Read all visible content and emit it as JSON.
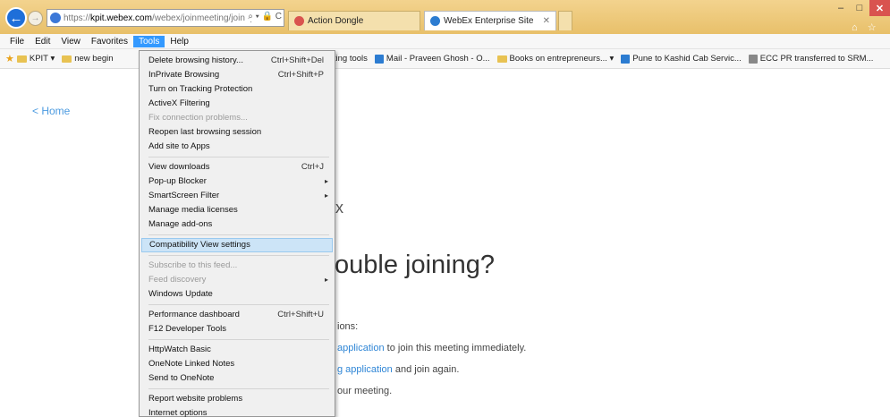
{
  "window": {
    "address": {
      "proto": "https://",
      "domain": "kpit.webex.com",
      "path": "/webex/joinmeeting/join?p",
      "controls": "⌕ ▾ 🔒 C"
    },
    "tabs": [
      {
        "label": "Action Dongle",
        "active": false
      },
      {
        "label": "WebEx Enterprise Site",
        "active": true
      }
    ],
    "controls": {
      "minimize": "–",
      "maximize": "□",
      "close": "✕",
      "tools": "⌂ ☆ ⚙"
    }
  },
  "menubar": {
    "items": [
      {
        "label": "File"
      },
      {
        "label": "Edit"
      },
      {
        "label": "View"
      },
      {
        "label": "Favorites"
      },
      {
        "label": "Tools"
      },
      {
        "label": "Help"
      }
    ]
  },
  "favorites": {
    "items": [
      {
        "label": "KPIT ▾",
        "icon": "folder"
      },
      {
        "label": "new begin",
        "icon": "folder"
      },
      {
        "label": "Ticketing tools",
        "icon": "none"
      },
      {
        "label": "Mail - Praveen Ghosh - O...",
        "icon": "page"
      },
      {
        "label": "Books on entrepreneurs... ▾",
        "icon": "folder"
      },
      {
        "label": "Pune to Kashid Cab Servic...",
        "icon": "page"
      },
      {
        "label": "ECC PR transferred to SRM...",
        "icon": "page"
      }
    ]
  },
  "page": {
    "home": "< Home",
    "heading_partial": "x",
    "heading": "ouble joining?",
    "tip1_prefix": "",
    "tip_intro": "ions:",
    "tip2_link": "application",
    "tip2_text": " to join this meeting immediately.",
    "tip3_link": "g application",
    "tip3_text": " and join again.",
    "tip4_text": "our meeting."
  },
  "tools_menu": {
    "items": [
      {
        "label": "Delete browsing history...",
        "shortcut": "Ctrl+Shift+Del"
      },
      {
        "label": "InPrivate Browsing",
        "shortcut": "Ctrl+Shift+P"
      },
      {
        "label": "Turn on Tracking Protection"
      },
      {
        "label": "ActiveX Filtering"
      },
      {
        "label": "Fix connection problems...",
        "disabled": true
      },
      {
        "label": "Reopen last browsing session"
      },
      {
        "label": "Add site to Apps"
      },
      {
        "sep": true
      },
      {
        "label": "View downloads",
        "shortcut": "Ctrl+J"
      },
      {
        "label": "Pop-up Blocker",
        "arrow": "▸"
      },
      {
        "label": "SmartScreen Filter",
        "arrow": "▸"
      },
      {
        "label": "Manage media licenses"
      },
      {
        "label": "Manage add-ons"
      },
      {
        "sep": true
      },
      {
        "label": "Compatibility View settings",
        "highlight": true
      },
      {
        "sep": true
      },
      {
        "label": "Subscribe to this feed...",
        "disabled": true
      },
      {
        "label": "Feed discovery",
        "disabled": true,
        "arrow": "▸"
      },
      {
        "label": "Windows Update"
      },
      {
        "sep": true
      },
      {
        "label": "Performance dashboard",
        "shortcut": "Ctrl+Shift+U"
      },
      {
        "label": "F12 Developer Tools"
      },
      {
        "sep": true
      },
      {
        "label": "HttpWatch Basic"
      },
      {
        "label": "OneNote Linked Notes"
      },
      {
        "label": "Send to OneNote"
      },
      {
        "sep": true
      },
      {
        "label": "Report website problems"
      },
      {
        "label": "Internet options"
      }
    ]
  },
  "colors": {
    "accent": "#3399ff",
    "link": "#2f86d6",
    "titlebar": "#e8c06a"
  }
}
